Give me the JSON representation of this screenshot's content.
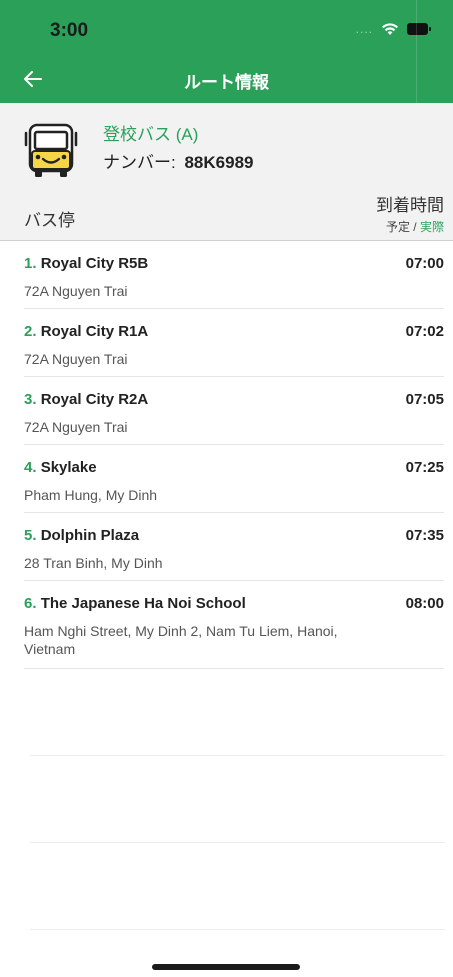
{
  "status_bar": {
    "time": "3:00"
  },
  "nav": {
    "title": "ルート情報"
  },
  "bus": {
    "name": "登校バス (A)",
    "plate_label": "ナンバー:",
    "plate_value": "88K6989"
  },
  "columns": {
    "stop_header": "バス停",
    "time_header": "到着時間",
    "legend_scheduled": "予定",
    "legend_sep": " / ",
    "legend_actual": "実際"
  },
  "stops": [
    {
      "num": "1.",
      "name": "Royal City R5B",
      "address": "72A Nguyen Trai",
      "time": "07:00"
    },
    {
      "num": "2.",
      "name": "Royal City R1A",
      "address": "72A Nguyen Trai",
      "time": "07:02"
    },
    {
      "num": "3.",
      "name": "Royal City R2A",
      "address": "72A Nguyen Trai",
      "time": "07:05"
    },
    {
      "num": "4.",
      "name": "Skylake",
      "address": "Pham Hung, My Dinh",
      "time": "07:25"
    },
    {
      "num": "5.",
      "name": "Dolphin Plaza",
      "address": "28 Tran Binh, My Dinh",
      "time": "07:35"
    },
    {
      "num": "6.",
      "name": "The Japanese Ha Noi School",
      "address": "Ham Nghi Street, My Dinh 2, Nam Tu Liem, Hanoi, Vietnam",
      "time": "08:00"
    }
  ],
  "colors": {
    "accent": "#2aa059",
    "bus_icon_yellow": "#f6d646"
  },
  "icons": {
    "back": "arrow-left-icon",
    "bus": "school-bus-icon",
    "wifi": "wifi-icon",
    "battery": "battery-icon"
  }
}
